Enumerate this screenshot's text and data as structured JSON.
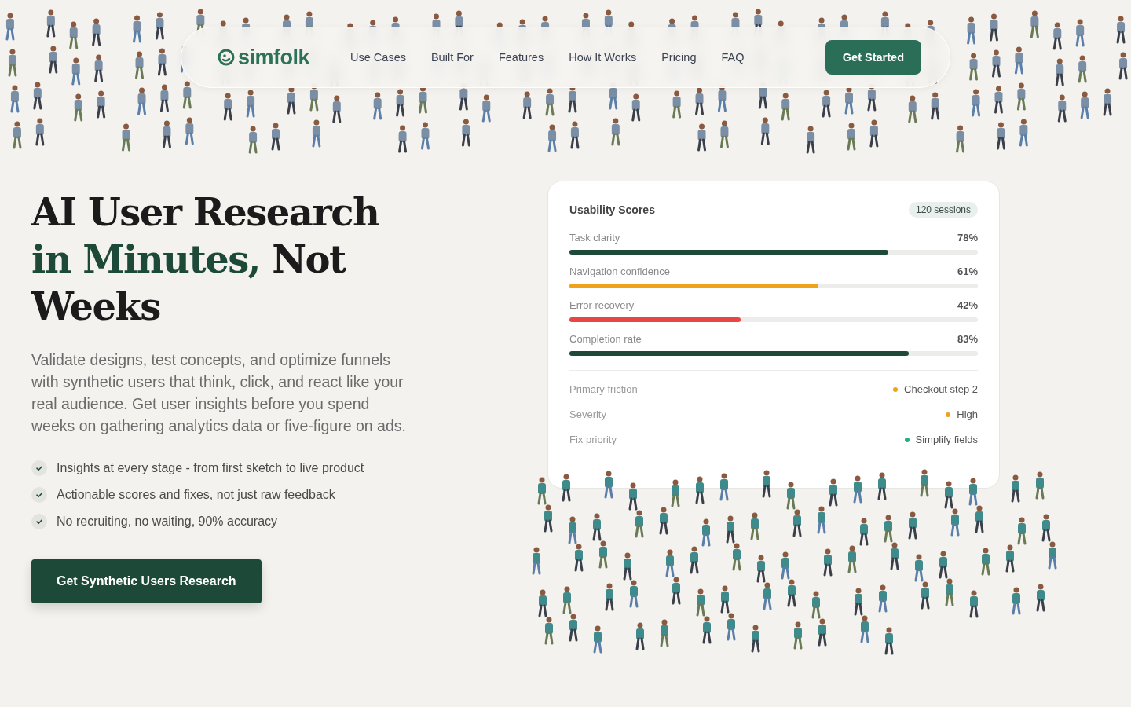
{
  "nav": {
    "logo": "simfolk",
    "links": [
      "Use Cases",
      "Built For",
      "Features",
      "How It Works",
      "Pricing",
      "FAQ"
    ],
    "cta": "Get Started"
  },
  "hero": {
    "title": [
      {
        "text": "AI User Research ",
        "accent": false
      },
      {
        "text": "in Minutes,",
        "accent": true
      },
      {
        "text": " Not Weeks",
        "accent": false
      }
    ],
    "description": "Validate designs, test concepts, and optimize funnels with synthetic users that think, click, and react like your real audience. Get user insights before you spend weeks on gathering analytics data or five-figure on ads.",
    "bullets": [
      "Insights at every stage - from first sketch to live product",
      "Actionable scores and fixes, not just raw feedback",
      "No recruiting, no waiting, 90% accuracy"
    ],
    "cta": "Get Synthetic Users Research"
  },
  "card": {
    "title": "Usability Scores",
    "badge": "120 sessions",
    "scores": [
      {
        "label": "Task clarity",
        "value": "78%",
        "level": 0.78,
        "color": "#1f4a3a"
      },
      {
        "label": "Navigation confidence",
        "value": "61%",
        "level": 0.61,
        "color": "#f0a21b"
      },
      {
        "label": "Error recovery",
        "value": "42%",
        "level": 0.42,
        "color": "#e84545"
      },
      {
        "label": "Completion rate",
        "value": "83%",
        "level": 0.83,
        "color": "#1f4a3a"
      }
    ],
    "details": [
      {
        "label": "Primary friction",
        "value": "Checkout step 2",
        "color": "#f0a21b"
      },
      {
        "label": "Severity",
        "value": "High",
        "color": "#f0a21b"
      },
      {
        "label": "Fix priority",
        "value": "Simplify fields",
        "color": "#22b07d"
      }
    ]
  }
}
